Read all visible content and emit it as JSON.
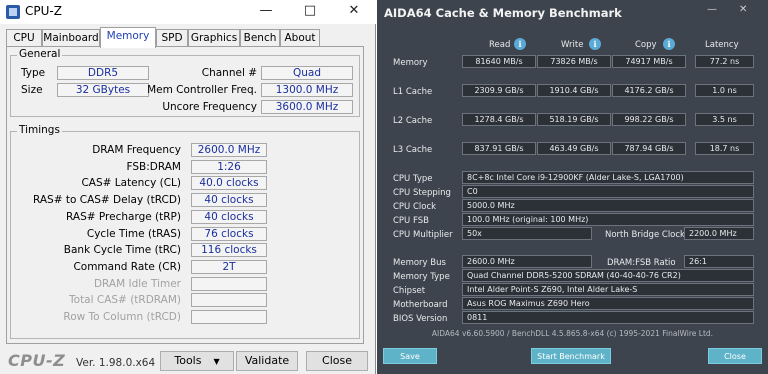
{
  "cpuz": {
    "title": "CPU-Z",
    "tabs": [
      "CPU",
      "Mainboard",
      "Memory",
      "SPD",
      "Graphics",
      "Bench",
      "About"
    ],
    "active_tab": "Memory",
    "general": {
      "title": "General",
      "type_label": "Type",
      "type_value": "DDR5",
      "size_label": "Size",
      "size_value": "32 GBytes",
      "channel_label": "Channel #",
      "channel_value": "Quad",
      "mem_ctrl_label": "Mem Controller Freq.",
      "mem_ctrl_value": "1300.0 MHz",
      "uncore_label": "Uncore Frequency",
      "uncore_value": "3600.0 MHz"
    },
    "timings": {
      "title": "Timings",
      "rows": [
        {
          "label": "DRAM Frequency",
          "value": "2600.0 MHz",
          "disabled": false
        },
        {
          "label": "FSB:DRAM",
          "value": "1:26",
          "disabled": false
        },
        {
          "label": "CAS# Latency (CL)",
          "value": "40.0 clocks",
          "disabled": false
        },
        {
          "label": "RAS# to CAS# Delay (tRCD)",
          "value": "40 clocks",
          "disabled": false
        },
        {
          "label": "RAS# Precharge (tRP)",
          "value": "40 clocks",
          "disabled": false
        },
        {
          "label": "Cycle Time (tRAS)",
          "value": "76 clocks",
          "disabled": false
        },
        {
          "label": "Bank Cycle Time (tRC)",
          "value": "116 clocks",
          "disabled": false
        },
        {
          "label": "Command Rate (CR)",
          "value": "2T",
          "disabled": false
        },
        {
          "label": "DRAM Idle Timer",
          "value": "",
          "disabled": true
        },
        {
          "label": "Total CAS# (tRDRAM)",
          "value": "",
          "disabled": true
        },
        {
          "label": "Row To Column (tRCD)",
          "value": "",
          "disabled": true
        }
      ]
    },
    "footer": {
      "logo": "CPU-Z",
      "version": "Ver. 1.98.0.x64",
      "tools_label": "Tools",
      "validate_label": "Validate",
      "close_label": "Close"
    }
  },
  "aida": {
    "title": "AIDA64 Cache & Memory Benchmark",
    "headers": {
      "read": "Read",
      "write": "Write",
      "copy": "Copy",
      "latency": "Latency"
    },
    "bench_rows": [
      {
        "label": "Memory",
        "read": "81640 MB/s",
        "write": "73826 MB/s",
        "copy": "74917 MB/s",
        "latency": "77.2 ns"
      },
      {
        "label": "L1 Cache",
        "read": "2309.9 GB/s",
        "write": "1910.4 GB/s",
        "copy": "4176.2 GB/s",
        "latency": "1.0 ns"
      },
      {
        "label": "L2 Cache",
        "read": "1278.4 GB/s",
        "write": "518.19 GB/s",
        "copy": "998.22 GB/s",
        "latency": "3.5 ns"
      },
      {
        "label": "L3 Cache",
        "read": "837.91 GB/s",
        "write": "463.49 GB/s",
        "copy": "787.94 GB/s",
        "latency": "18.7 ns"
      }
    ],
    "cpu_type_label": "CPU Type",
    "cpu_type_value": "8C+8c Intel Core i9-12900KF  (Alder Lake-S, LGA1700)",
    "cpu_stepping_label": "CPU Stepping",
    "cpu_stepping_value": "C0",
    "cpu_clock_label": "CPU Clock",
    "cpu_clock_value": "5000.0 MHz",
    "cpu_fsb_label": "CPU FSB",
    "cpu_fsb_value": "100.0 MHz  (original: 100 MHz)",
    "cpu_mult_label": "CPU Multiplier",
    "cpu_mult_value": "50x",
    "nb_clock_label": "North Bridge Clock",
    "nb_clock_value": "2200.0 MHz",
    "mem_bus_label": "Memory Bus",
    "mem_bus_value": "2600.0 MHz",
    "dram_fsb_label": "DRAM:FSB Ratio",
    "dram_fsb_value": "26:1",
    "mem_type_label": "Memory Type",
    "mem_type_value": "Quad Channel DDR5-5200 SDRAM  (40-40-40-76 CR2)",
    "chipset_label": "Chipset",
    "chipset_value": "Intel Alder Point-S Z690, Intel Alder Lake-S",
    "motherboard_label": "Motherboard",
    "motherboard_value": "Asus ROG Maximus Z690 Hero",
    "bios_label": "BIOS Version",
    "bios_value": "0811",
    "footer_text": "AIDA64 v6.60.5900 / BenchDLL 4.5.865.8-x64  (c) 1995-2021 FinalWire Ltd.",
    "save_label": "Save",
    "start_label": "Start Benchmark",
    "close_label": "Close"
  }
}
